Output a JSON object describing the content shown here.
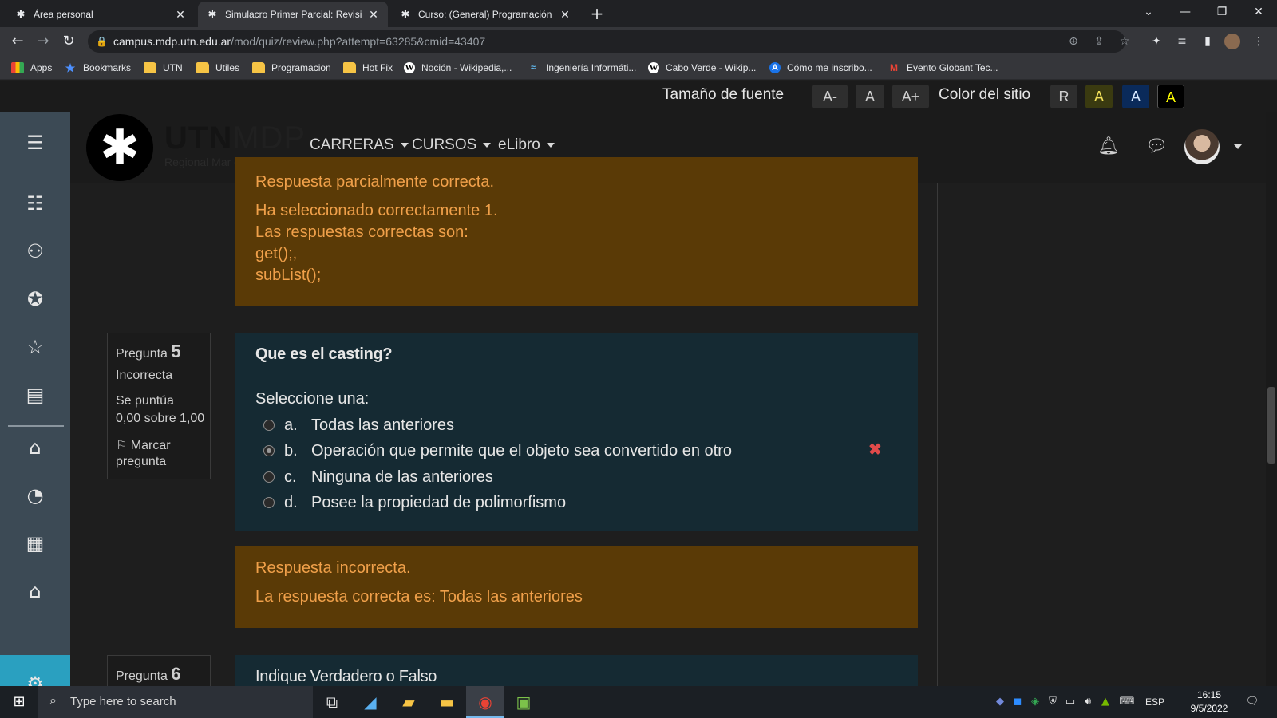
{
  "browser": {
    "tabs": [
      {
        "title": "Área personal",
        "active": false
      },
      {
        "title": "Simulacro Primer Parcial: Revisión",
        "active": true
      },
      {
        "title": "Curso: (General) Programación y",
        "active": false
      }
    ],
    "url_host": "campus.mdp.utn.edu.ar",
    "url_path": "/mod/quiz/review.php?attempt=63285&cmid=43407",
    "bookmarks": [
      "Apps",
      "Bookmarks",
      "UTN",
      "Utiles",
      "Programacion",
      "Hot Fix",
      "Noción - Wikipedia,...",
      "Ingeniería Informáti...",
      "Cabo Verde - Wikip...",
      "Cómo me inscribo...",
      "Evento Globant Tec..."
    ]
  },
  "accessibility": {
    "font_size_label": "Tamaño de fuente",
    "font_buttons": [
      "A-",
      "A",
      "A+"
    ],
    "color_label": "Color del sitio",
    "color_buttons": [
      "R",
      "A",
      "A",
      "A"
    ]
  },
  "header": {
    "logo_bold": "UTN",
    "logo_light": "MDP",
    "logo_subtitle": "Regional Mar del Plata",
    "nav": [
      "CARRERAS",
      "CURSOS",
      "eLibro"
    ]
  },
  "prev_feedback": {
    "lines": [
      "Respuesta parcialmente correcta.",
      "Ha seleccionado correctamente 1.",
      "Las respuestas correctas son:",
      "get();,",
      "subList();"
    ]
  },
  "question5": {
    "label": "Pregunta",
    "number": "5",
    "status": "Incorrecta",
    "score_line1": "Se puntúa",
    "score_line2": "0,00 sobre 1,00",
    "flag_line1": "Marcar",
    "flag_line2": "pregunta",
    "text": "Que es el casting?",
    "prompt": "Seleccione una:",
    "options": [
      {
        "letter": "a.",
        "text": "Todas las anteriores",
        "selected": false
      },
      {
        "letter": "b.",
        "text": "Operación que permite que el objeto sea convertido en otro",
        "selected": true
      },
      {
        "letter": "c.",
        "text": "Ninguna de las anteriores",
        "selected": false
      },
      {
        "letter": "d.",
        "text": "Posee la propiedad de polimorfismo",
        "selected": false
      }
    ],
    "wrong_mark": "✖"
  },
  "feedback5": {
    "line1": "Respuesta incorrecta.",
    "line2": "La respuesta correcta es: Todas las anteriores"
  },
  "question6": {
    "label": "Pregunta",
    "number": "6",
    "text": "Indique Verdadero o Falso"
  },
  "taskbar": {
    "search_placeholder": "Type here to search",
    "language": "ESP",
    "time": "16:15",
    "date": "9/5/2022",
    "notifications": "1"
  },
  "colors": {
    "feedback_bg": "#5a3a06",
    "feedback_text": "#f0a04a",
    "question_bg": "#152a33",
    "sidebar_bg": "#3c4a55",
    "wrong": "#e04a4a"
  }
}
